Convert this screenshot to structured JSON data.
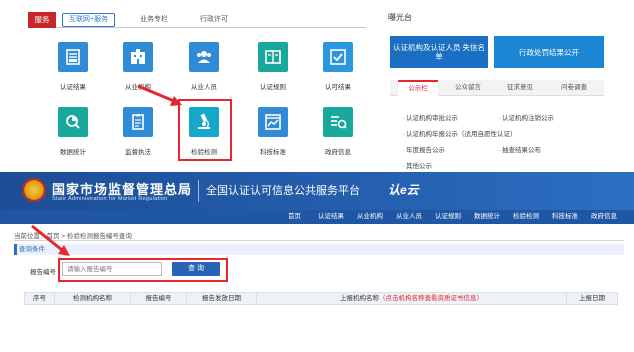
{
  "top_panel": {
    "tabs": [
      {
        "label": "服务"
      },
      {
        "label": "互联网+服务"
      },
      {
        "label": "业务专栏"
      },
      {
        "label": "行政许可"
      }
    ],
    "services": [
      {
        "label": "认证结果",
        "icon": "certificate-result-icon"
      },
      {
        "label": "从业机构",
        "icon": "institution-icon"
      },
      {
        "label": "从业人员",
        "icon": "personnel-icon"
      },
      {
        "label": "认证规则",
        "icon": "rule-book-icon"
      },
      {
        "label": "认可结果",
        "icon": "checklist-icon"
      },
      {
        "label": "数据统计",
        "icon": "data-stats-icon"
      },
      {
        "label": "监督执法",
        "icon": "clipboard-icon"
      },
      {
        "label": "检验检测",
        "icon": "microscope-icon"
      },
      {
        "label": "科技标准",
        "icon": "browser-chart-icon"
      },
      {
        "label": "政府信息",
        "icon": "info-list-icon"
      }
    ],
    "sidebar": {
      "title": "曝光台",
      "banner1": "认证机构及认证人员 失信名单",
      "banner2": "行政处罚结果公开",
      "tabs": [
        "公示栏",
        "公众留言",
        "征求意见",
        "问卷调查"
      ],
      "links_left": [
        "认证机构审批公示",
        "认证机构年报公示（适用自愿性认证）",
        "年度报告公示",
        "其他公示"
      ],
      "links_right": [
        "认证机构注销公示",
        "抽查结果公布"
      ]
    }
  },
  "bottom_panel": {
    "header": {
      "title": "国家市场监督管理总局",
      "title_en": "State Administration  for  Market Regulation",
      "subtitle": "全国认证认可信息公共服务平台",
      "logo_text": "认e云"
    },
    "nav": [
      "首页",
      "认证结果",
      "从业机构",
      "从业人员",
      "认证规则",
      "数据统计",
      "检验检测",
      "科技标准",
      "政府信息"
    ],
    "breadcrumb": "当前位置：首页 > 检验检测报告编号查询",
    "query_bar_label": "查询条件",
    "field_label": "报告编号",
    "field_placeholder": "请输入报告编号",
    "query_button": "查 询",
    "table_headers": {
      "seq": "序号",
      "org": "检测机构名称",
      "report_no": "报告编号",
      "issue_date": "报告发放日期",
      "upload_org": "上报机构名称",
      "upload_note": "（点击机构名称查看资质证书信息）",
      "upload_date": "上报日期"
    }
  },
  "colors": {
    "accent_red": "#e8262d",
    "header_blue": "#1d4d95",
    "button_blue": "#2a63b5"
  }
}
